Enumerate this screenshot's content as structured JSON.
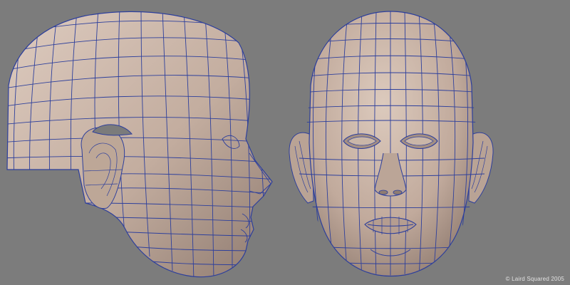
{
  "credit": {
    "text": "© Laird Squared 2005"
  },
  "colors": {
    "background": "#7c7c7c",
    "skin_light": "#d5c2b6",
    "skin_mid": "#b8a294",
    "skin_dark": "#8f7c71",
    "wireframe": "#2d3f9c"
  },
  "views": [
    {
      "name": "side-view",
      "model": "head-mesh"
    },
    {
      "name": "front-view",
      "model": "head-mesh"
    }
  ]
}
